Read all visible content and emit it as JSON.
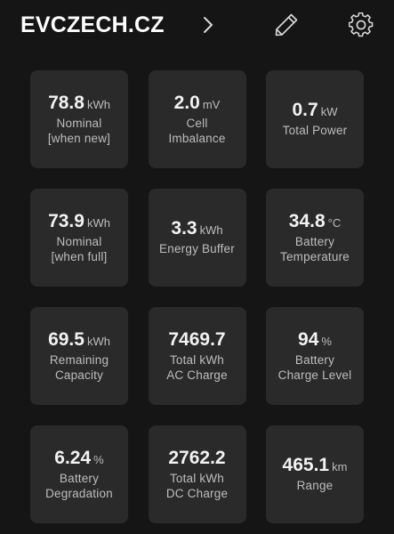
{
  "header": {
    "title": "EVCZECH.CZ",
    "icons": [
      "chevron-right-icon",
      "pencil-icon",
      "gear-icon"
    ]
  },
  "tiles": [
    {
      "value": "78.8",
      "unit": "kWh",
      "label": [
        "Nominal",
        "[when new]"
      ]
    },
    {
      "value": "2.0",
      "unit": "mV",
      "label": [
        "Cell",
        "Imbalance"
      ]
    },
    {
      "value": "0.7",
      "unit": "kW",
      "label": [
        "Total Power"
      ]
    },
    {
      "value": "73.9",
      "unit": "kWh",
      "label": [
        "Nominal",
        "[when full]"
      ]
    },
    {
      "value": "3.3",
      "unit": "kWh",
      "label": [
        "Energy Buffer"
      ]
    },
    {
      "value": "34.8",
      "unit": "°C",
      "label": [
        "Battery",
        "Temperature"
      ]
    },
    {
      "value": "69.5",
      "unit": "kWh",
      "label": [
        "Remaining",
        "Capacity"
      ]
    },
    {
      "value": "7469.7",
      "unit": "",
      "label": [
        "Total kWh",
        "AC Charge"
      ]
    },
    {
      "value": "94",
      "unit": "%",
      "label": [
        "Battery",
        "Charge Level"
      ]
    },
    {
      "value": "6.24",
      "unit": "%",
      "label": [
        "Battery",
        "Degradation"
      ]
    },
    {
      "value": "2762.2",
      "unit": "",
      "label": [
        "Total kWh",
        "DC Charge"
      ]
    },
    {
      "value": "465.1",
      "unit": "km",
      "label": [
        "Range"
      ]
    }
  ],
  "colors": {
    "background": "#151515",
    "tile": "#2a2a2a",
    "value_text": "#f2f2f2",
    "label_text": "#bdbdbd",
    "icon": "#d9d9d9"
  }
}
